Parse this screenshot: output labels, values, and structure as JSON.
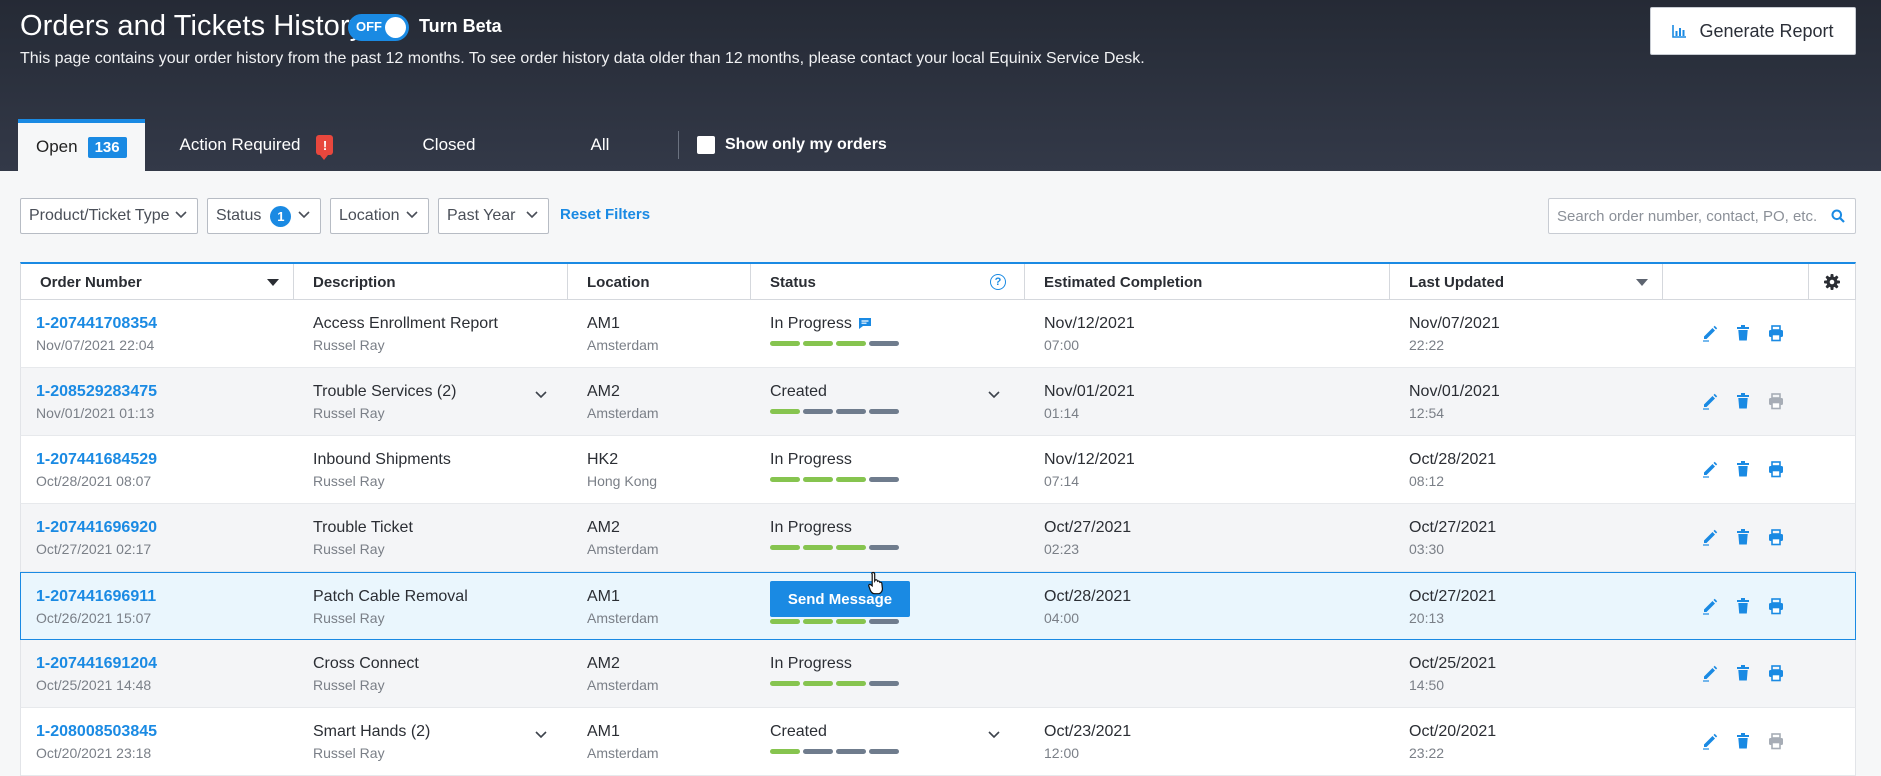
{
  "header": {
    "title": "Orders and Tickets History",
    "toggle_state": "OFF",
    "toggle_label": "Turn Beta",
    "description": "This page contains your order history from the past 12 months. To see order history data older than 12 months, please contact your local Equinix Service Desk.",
    "report_button": "Generate Report"
  },
  "tabs": {
    "open_label": "Open",
    "open_count": "136",
    "action_label": "Action Required",
    "action_badge": "!",
    "closed_label": "Closed",
    "all_label": "All",
    "show_mine_label": "Show only my orders"
  },
  "filters": {
    "product": "Product/Ticket Type",
    "status": "Status",
    "status_count": "1",
    "location": "Location",
    "period": "Past Year",
    "reset": "Reset Filters",
    "search_placeholder": "Search order number, contact, PO, etc."
  },
  "table": {
    "columns": {
      "order_number": "Order Number",
      "description": "Description",
      "location": "Location",
      "status": "Status",
      "help": "?",
      "estimated": "Estimated Completion",
      "updated": "Last Updated"
    },
    "send_message": "Send Message",
    "rows": [
      {
        "order": "1-207441708354",
        "created": "Nov/07/2021 22:04",
        "desc": "Access Enrollment Report",
        "contact": "Russel Ray",
        "loc": "AM1",
        "city": "Amsterdam",
        "status": "In Progress",
        "progress": 3,
        "est_date": "Nov/12/2021",
        "est_time": "07:00",
        "upd_date": "Nov/07/2021",
        "upd_time": "22:22"
      },
      {
        "order": "1-208529283475",
        "created": "Nov/01/2021 01:13",
        "desc": "Trouble Services (2)",
        "contact": "Russel Ray",
        "loc": "AM2",
        "city": "Amsterdam",
        "status": "Created",
        "progress": 1,
        "est_date": "Nov/01/2021",
        "est_time": "01:14",
        "upd_date": "Nov/01/2021",
        "upd_time": "12:54"
      },
      {
        "order": "1-207441684529",
        "created": "Oct/28/2021 08:07",
        "desc": "Inbound Shipments",
        "contact": "Russel Ray",
        "loc": "HK2",
        "city": "Hong Kong",
        "status": "In Progress",
        "progress": 3,
        "est_date": "Nov/12/2021",
        "est_time": "07:14",
        "upd_date": "Oct/28/2021",
        "upd_time": "08:12"
      },
      {
        "order": "1-207441696920",
        "created": "Oct/27/2021 02:17",
        "desc": "Trouble Ticket",
        "contact": "Russel Ray",
        "loc": "AM2",
        "city": "Amsterdam",
        "status": "In Progress",
        "progress": 3,
        "est_date": "Oct/27/2021",
        "est_time": "02:23",
        "upd_date": "Oct/27/2021",
        "upd_time": "03:30"
      },
      {
        "order": "1-207441696911",
        "created": "Oct/26/2021 15:07",
        "desc": "Patch Cable Removal",
        "contact": "Russel Ray",
        "loc": "AM1",
        "city": "Amsterdam",
        "status": "",
        "progress": 3,
        "est_date": "Oct/28/2021",
        "est_time": "04:00",
        "upd_date": "Oct/27/2021",
        "upd_time": "20:13"
      },
      {
        "order": "1-207441691204",
        "created": "Oct/25/2021 14:48",
        "desc": "Cross Connect",
        "contact": "Russel Ray",
        "loc": "AM2",
        "city": "Amsterdam",
        "status": "In Progress",
        "progress": 3,
        "est_date": "",
        "est_time": "",
        "upd_date": "Oct/25/2021",
        "upd_time": "14:50"
      },
      {
        "order": "1-208008503845",
        "created": "Oct/20/2021 23:18",
        "desc": "Smart Hands (2)",
        "contact": "Russel Ray",
        "loc": "AM1",
        "city": "Amsterdam",
        "status": "Created",
        "progress": 1,
        "est_date": "Oct/23/2021",
        "est_time": "12:00",
        "upd_date": "Oct/20/2021",
        "upd_time": "23:22"
      }
    ]
  }
}
